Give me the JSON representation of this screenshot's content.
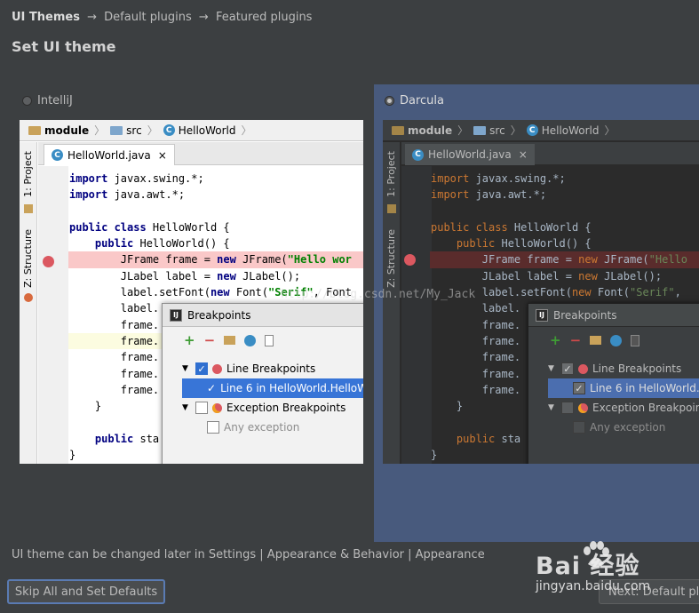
{
  "wizard": {
    "current_step": "UI Themes",
    "step2": "Default plugins",
    "step3": "Featured plugins",
    "arrow": "→",
    "title": "Set UI theme"
  },
  "themes": {
    "light": {
      "name": "IntelliJ",
      "selected": false,
      "nav_module": "module",
      "nav_src": "src",
      "nav_class": "HelloWorld",
      "tab_file": "HelloWorld.java",
      "tab_close": "×",
      "side_project": "1: Project",
      "side_structure": "Z: Structure",
      "dialog_title": "Breakpoints",
      "tree": {
        "line_bp": "Line Breakpoints",
        "line6": "Line 6 in HelloWorld.HelloW",
        "exc_bp": "Exception Breakpoints",
        "any_exc": "Any exception"
      }
    },
    "dark": {
      "name": "Darcula",
      "selected": true,
      "nav_module": "module",
      "nav_src": "src",
      "nav_class": "HelloWorld",
      "tab_file": "HelloWorld.java",
      "tab_close": "×",
      "side_project": "1: Project",
      "side_structure": "Z: Structure",
      "dialog_title": "Breakpoints",
      "tree": {
        "line_bp": "Line Breakpoints",
        "line6": "Line 6 in HelloWorld.",
        "exc_bp": "Exception Breakpoints",
        "any_exc": "Any exception"
      }
    }
  },
  "code_light": {
    "l1a": "import",
    "l1b": " javax.swing.*;",
    "l2a": "import",
    "l2b": " java.awt.*;",
    "l4a": "public class",
    "l4b": " HelloWorld {",
    "l5a": "    public",
    "l5b": " HelloWorld() {",
    "l6a": "        JFrame frame = ",
    "l6b": "new",
    "l6c": " JFrame(",
    "l6d": "\"Hello wor",
    "l7a": "        JLabel label = ",
    "l7b": "new",
    "l7c": " JLabel();",
    "l8a": "        label.setFont(",
    "l8b": "new",
    "l8c": " Font(",
    "l8d": "\"Serif\"",
    "l8e": ", Font",
    "l9": "        label.",
    "l10": "        frame.",
    "l11": "        frame.",
    "l12": "        frame.",
    "l13": "        frame.",
    "l14": "        frame.",
    "l15": "    }",
    "l17a": "    public",
    "l17b": " sta",
    "l18": "}"
  },
  "code_dark": {
    "l1a": "import",
    "l1b": " javax.swing.*;",
    "l2a": "import",
    "l2b": " java.awt.*;",
    "l4a": "public class",
    "l4b": " HelloWorld {",
    "l5a": "    public",
    "l5b": " HelloWorld() {",
    "l6a": "        JFrame frame = ",
    "l6b": "new",
    "l6c": " JFrame(",
    "l6d": "\"Hello",
    "l7a": "        JLabel label = ",
    "l7b": "new",
    "l7c": " JLabel();",
    "l8a": "        label.setFont(",
    "l8b": "new",
    "l8c": " Font(",
    "l8d": "\"Serif\"",
    "l8e": ",",
    "l9": "        label.",
    "l10": "        frame.",
    "l11": "        frame.",
    "l12": "        frame.",
    "l13": "        frame.",
    "l14": "        frame.",
    "l15": "    }",
    "l17a": "    public",
    "l17b": " sta",
    "l18": "}"
  },
  "footer": {
    "note": "UI theme can be changed later in Settings | Appearance & Behavior | Appearance",
    "skip_button": "Skip All and Set Defaults",
    "next_button": "Next: Default plu"
  },
  "watermark": {
    "text": "http://blog.csdn.net/My_Jack",
    "baidu_logo": "Bai  经验",
    "baidu_url": "jingyan.baidu.com"
  },
  "colors": {
    "background": "#3c3f41",
    "darcula_selection": "#485a7d",
    "breakpoint_red": "#db5860",
    "selection_blue": "#3875d7"
  }
}
